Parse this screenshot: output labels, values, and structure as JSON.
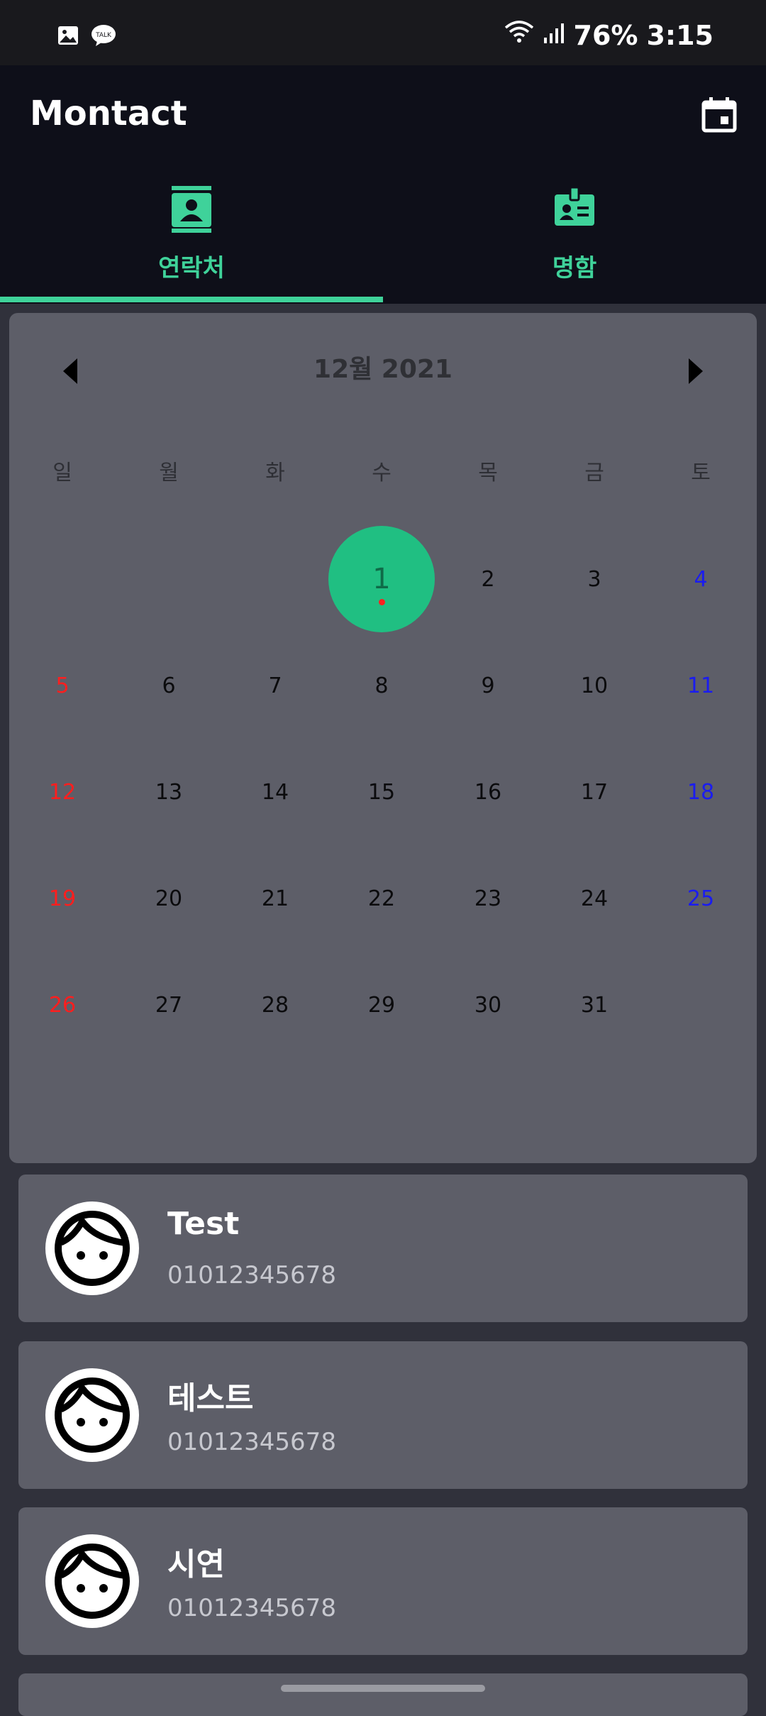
{
  "status": {
    "battery": "76%",
    "time": "3:15",
    "talk": "TALK"
  },
  "app": {
    "title": "Montact"
  },
  "tabs": [
    {
      "label": "연락처",
      "icon": "contact-book-icon",
      "active": true
    },
    {
      "label": "명함",
      "icon": "business-card-icon",
      "active": false
    }
  ],
  "calendar": {
    "month_title": "12월 2021",
    "weekdays": [
      "일",
      "월",
      "화",
      "수",
      "목",
      "금",
      "토"
    ],
    "weeks": [
      [
        "",
        "",
        "",
        "1",
        "2",
        "3",
        "4"
      ],
      [
        "5",
        "6",
        "7",
        "8",
        "9",
        "10",
        "11"
      ],
      [
        "12",
        "13",
        "14",
        "15",
        "16",
        "17",
        "18"
      ],
      [
        "19",
        "20",
        "21",
        "22",
        "23",
        "24",
        "25"
      ],
      [
        "26",
        "27",
        "28",
        "29",
        "30",
        "31",
        ""
      ]
    ],
    "selected_day": "1",
    "colors": {
      "selected": "#20bf82",
      "sunday": "#ff1e1e",
      "saturday": "#1a1cf0",
      "event_dot": "#ff2020"
    }
  },
  "contacts": [
    {
      "name": "Test",
      "phone": "01012345678"
    },
    {
      "name": "테스트",
      "phone": "01012345678"
    },
    {
      "name": "시연",
      "phone": "01012345678"
    }
  ],
  "accent": "#3fd29a"
}
